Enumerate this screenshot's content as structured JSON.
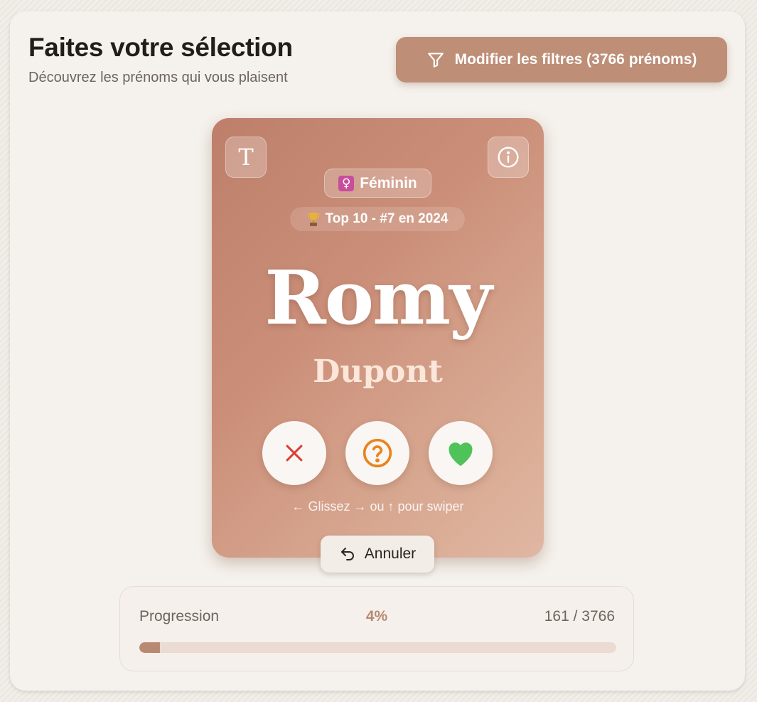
{
  "header": {
    "title": "Faites votre sélection",
    "subtitle": "Découvrez les prénoms qui vous plaisent",
    "filter_button_label": "Modifier les filtres (3766 prénoms)"
  },
  "card": {
    "gender_label": "Féminin",
    "gender_icon": "female-sign-icon",
    "rank_label": "Top 10 - #7 en 2024",
    "first_name": "Romy",
    "last_name": "Dupont",
    "hint": "← Glissez → ou ↑ pour swiper",
    "buttons": {
      "reject_icon": "x-icon",
      "maybe_icon": "question-circle-icon",
      "like_icon": "heart-icon"
    }
  },
  "undo": {
    "label": "Annuler",
    "icon": "undo-arrow-icon"
  },
  "progress": {
    "label": "Progression",
    "percent_text": "4%",
    "count_text": "161 / 3766",
    "value": 0.043
  },
  "colors": {
    "accent": "#be8e76",
    "reject": "#d9423b",
    "maybe": "#e8841e",
    "like": "#4fc35a"
  }
}
